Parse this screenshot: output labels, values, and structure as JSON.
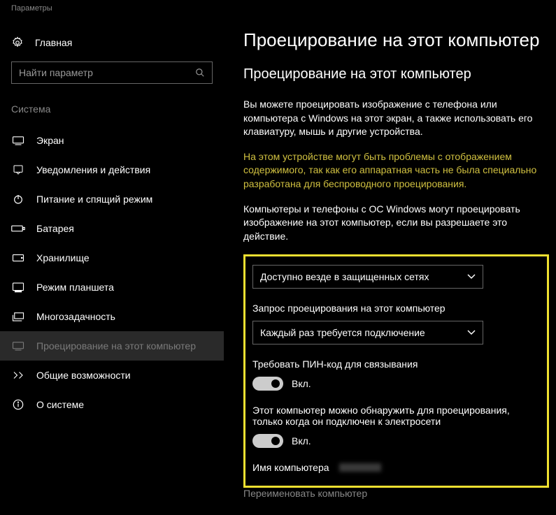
{
  "window": {
    "title": "Параметры"
  },
  "sidebar": {
    "home": "Главная",
    "search_placeholder": "Найти параметр",
    "section": "Система",
    "items": [
      {
        "label": "Экран"
      },
      {
        "label": "Уведомления и действия"
      },
      {
        "label": "Питание и спящий режим"
      },
      {
        "label": "Батарея"
      },
      {
        "label": "Хранилище"
      },
      {
        "label": "Режим планшета"
      },
      {
        "label": "Многозадачность"
      },
      {
        "label": "Проецирование на этот компьютер"
      },
      {
        "label": "Общие возможности"
      },
      {
        "label": "О системе"
      }
    ]
  },
  "main": {
    "heading": "Проецирование на этот компьютер",
    "subheading": "Проецирование на этот компьютер",
    "desc1": "Вы можете проецировать изображение с телефона или компьютера с Windows на этот экран, а также использовать его клавиатуру, мышь и другие устройства.",
    "warning": "На этом устройстве могут быть проблемы с отображением содержимого, так как его аппаратная часть не была специально разработана для беспроводного проецирования.",
    "desc2": "Компьютеры и телефоны с ОС Windows могут проецировать изображение на этот компьютер, если вы разрешаете это действие.",
    "dropdown1": "Доступно везде в защищенных сетях",
    "label_request": "Запрос проецирования на этот компьютер",
    "dropdown2": "Каждый раз требуется подключение",
    "label_pin": "Требовать ПИН-код для связывания",
    "toggle1": "Вкл.",
    "label_power": "Этот компьютер можно обнаружить для проецирования, только когда он подключен к электросети",
    "toggle2": "Вкл.",
    "pc_name_label": "Имя компьютера",
    "rename": "Переименовать компьютер"
  }
}
